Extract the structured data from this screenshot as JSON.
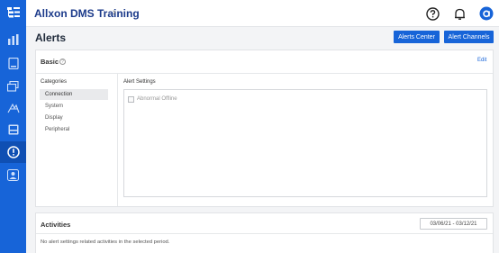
{
  "app": {
    "title": "Allxon DMS Training",
    "chevron": "›"
  },
  "page": {
    "title": "Alerts"
  },
  "header_buttons": {
    "alerts_center": "Alerts Center",
    "alert_channels": "Alert Channels"
  },
  "basic": {
    "title": "Basic",
    "help": "?",
    "edit": "Edit",
    "categories_label": "Categories",
    "categories": [
      "Connection",
      "System",
      "Display",
      "Peripheral"
    ],
    "selected_category": "Connection",
    "alert_settings_label": "Alert Settings",
    "settings": [
      {
        "label": "Abnormal Offline",
        "checked": false
      }
    ]
  },
  "activities": {
    "title": "Activities",
    "date_range": "03/06/21 - 03/12/21",
    "empty_message": "No alert settings related activities in the selected period."
  },
  "rail_icons": [
    "menu-icon",
    "bar-chart-icon",
    "device-icon",
    "layers-icon",
    "tools-icon",
    "inbox-icon",
    "alert-icon",
    "user-badge-icon"
  ],
  "top_icons": [
    "help-icon",
    "bell-icon",
    "avatar-icon"
  ],
  "colors": {
    "accent": "#1764d8",
    "rail": "#1764d8",
    "title": "#1b3a8a"
  }
}
